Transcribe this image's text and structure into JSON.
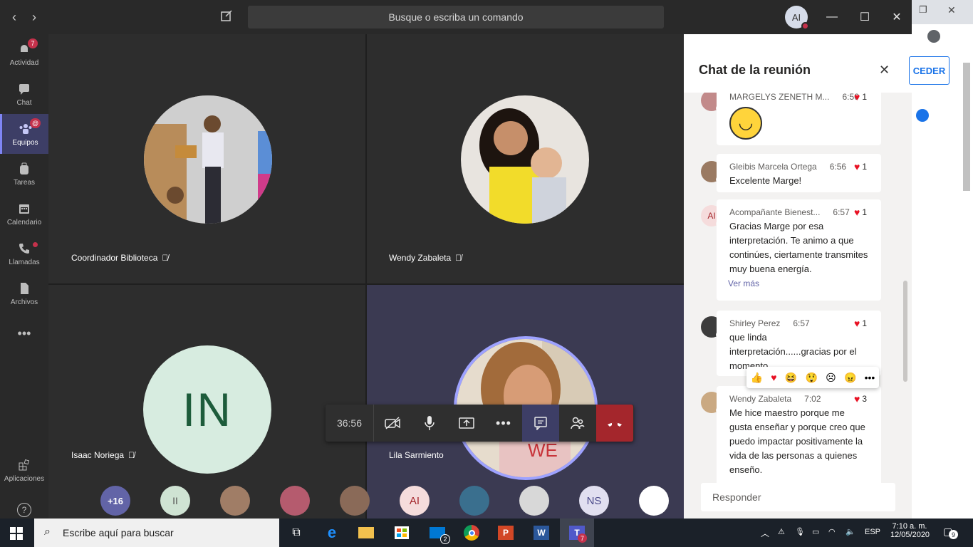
{
  "titlebar": {
    "search_placeholder": "Busque o escriba un comando",
    "avatar_initials": "AI"
  },
  "rail": [
    {
      "label": "Actividad",
      "badge": "7"
    },
    {
      "label": "Chat"
    },
    {
      "label": "Equipos",
      "badge": "@"
    },
    {
      "label": "Tareas"
    },
    {
      "label": "Calendario"
    },
    {
      "label": "Llamadas"
    },
    {
      "label": "Archivos"
    },
    {
      "label": "Aplicaciones"
    }
  ],
  "tiles": [
    {
      "name": "Coordinador Biblioteca"
    },
    {
      "name": "Wendy Zabaleta"
    },
    {
      "name": "Isaac Noriega",
      "initials": "IN"
    },
    {
      "name": "Lila Sarmiento"
    }
  ],
  "controls": {
    "timer": "36:56"
  },
  "participants": {
    "more": "+16",
    "initials_1": "AI",
    "initials_2": "NS"
  },
  "chat": {
    "title": "Chat de la reunión",
    "messages": [
      {
        "author": "MARGELYS ZENETH M...",
        "time": "6:56",
        "likes": "1"
      },
      {
        "author": "Gleibis Marcela Ortega",
        "time": "6:56",
        "likes": "1",
        "text": "Excelente Marge!"
      },
      {
        "author": "Acompañante Bienest...",
        "time": "6:57",
        "likes": "1",
        "avatar": "AI",
        "text": "Gracias Marge por esa interpretación. Te animo a que continúes, ciertamente transmites muy buena energía.",
        "more": "Ver más"
      },
      {
        "author": "Shirley Perez",
        "time": "6:57",
        "likes": "1",
        "text": "que linda interpretación......gracias por el momento"
      },
      {
        "author": "Wendy Zabaleta",
        "time": "7:02",
        "likes": "3",
        "text": "Me hice maestro porque me gusta enseñar y porque creo que puedo impactar positivamente la vida de las personas a quienes enseño."
      }
    ],
    "reply_placeholder": "Responder"
  },
  "browser": {
    "button": "CEDER"
  },
  "taskbar": {
    "search": "Escribe aquí para buscar",
    "mail_badge": "2",
    "teams_badge": "7",
    "lang": "ESP",
    "time": "7:10 a. m.",
    "date": "12/05/2020",
    "notif": "9"
  },
  "colors": {
    "accent": "#6264a7",
    "hangup": "#a4262c",
    "alert": "#c4314b"
  }
}
